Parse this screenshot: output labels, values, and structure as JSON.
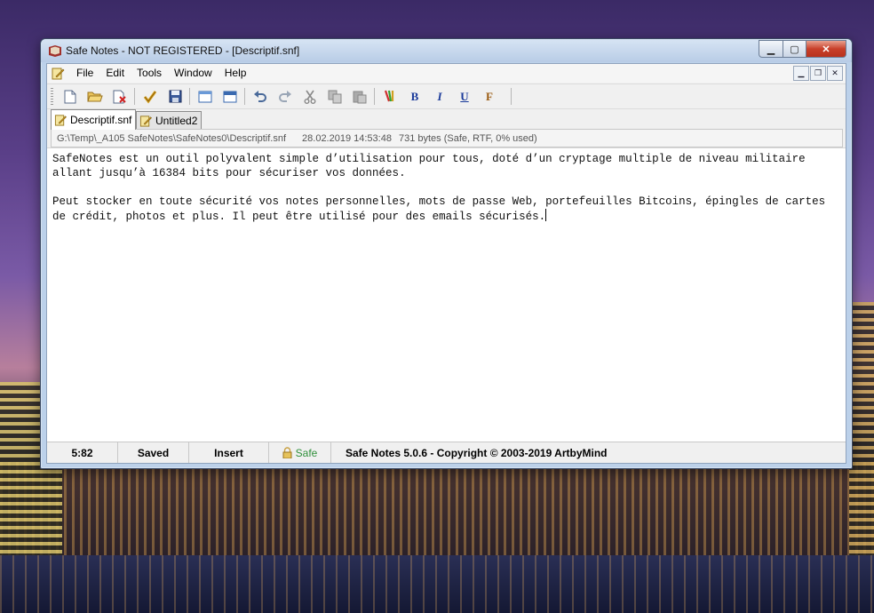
{
  "window": {
    "title": "Safe Notes - NOT REGISTERED - [Descriptif.snf]"
  },
  "menu": {
    "items": [
      "File",
      "Edit",
      "Tools",
      "Window",
      "Help"
    ]
  },
  "toolbar": {
    "buttons": [
      "new-icon",
      "open-icon",
      "delete-icon",
      "check-icon",
      "save-icon",
      "window-icon",
      "window2-icon",
      "undo-icon",
      "redo-icon",
      "cut-icon",
      "copy-icon",
      "paste-icon",
      "color-icon",
      "bold-icon",
      "italic-icon",
      "underline-icon",
      "font-icon"
    ],
    "bold": "B",
    "italic": "I",
    "underline": "U",
    "font": "F"
  },
  "tabs": [
    {
      "label": "Descriptif.snf",
      "active": true
    },
    {
      "label": "Untitled2",
      "active": false
    }
  ],
  "pathbar": {
    "path": "G:\\Temp\\_A105 SafeNotes\\SafeNotes0\\Descriptif.snf",
    "date": "28.02.2019 14:53:48",
    "info": "731 bytes (Safe, RTF, 0% used)"
  },
  "editor": {
    "paragraph1": "SafeNotes est un outil polyvalent simple d’utilisation pour tous, doté d’un cryptage multiple de niveau militaire allant jusqu’à 16384 bits pour sécuriser vos données.",
    "paragraph2": "Peut stocker en toute sécurité vos notes personnelles, mots de passe Web, portefeuilles Bitcoins, épingles de cartes de crédit, photos et plus. Il peut être utilisé pour des emails sécurisés."
  },
  "status": {
    "position": "5:82",
    "saved": "Saved",
    "mode": "Insert",
    "safe": "Safe",
    "copyright": "Safe Notes 5.0.6  -  Copyright © 2003-2019 ArtbyMind"
  },
  "colors": {
    "titlebar": "#bcd1ea",
    "close": "#c8402a",
    "safe_green": "#2f8f3a"
  }
}
